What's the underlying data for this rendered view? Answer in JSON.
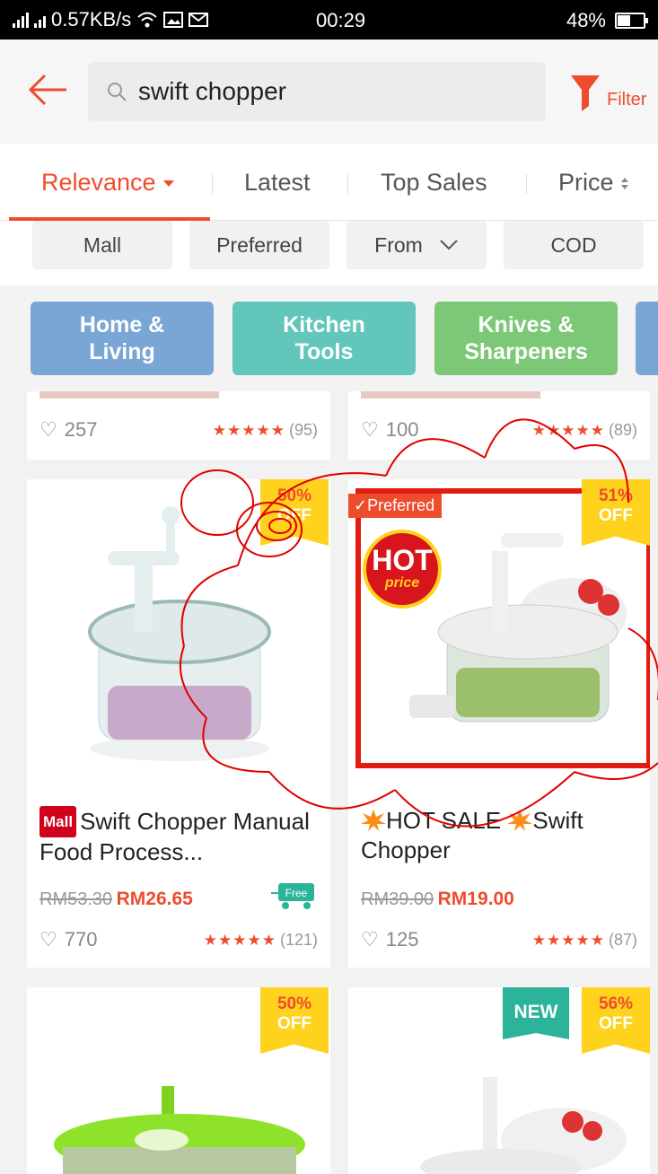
{
  "status_bar": {
    "network_speed": "0.57KB/s",
    "time": "00:29",
    "battery": "48%"
  },
  "header": {
    "search_query": "swift chopper",
    "filter_label": "Filter"
  },
  "sort_tabs": [
    {
      "label": "Relevance"
    },
    {
      "label": "Latest"
    },
    {
      "label": "Top Sales"
    },
    {
      "label": "Price"
    }
  ],
  "filter_chips": [
    {
      "label": "Mall"
    },
    {
      "label": "Preferred"
    },
    {
      "label": "From"
    },
    {
      "label": "COD"
    }
  ],
  "categories": [
    {
      "line1": "Home &",
      "line2": "Living",
      "color": "#7aa6d6"
    },
    {
      "line1": "Kitchen",
      "line2": "Tools",
      "color": "#62c6bb"
    },
    {
      "line1": "Knives &",
      "line2": "Sharpeners",
      "color": "#7cc877"
    }
  ],
  "top_row": [
    {
      "likes": "257",
      "stars": "★★★★★",
      "rating_count": "(95)"
    },
    {
      "likes": "100",
      "stars": "★★★★★",
      "rating_count": "(89)"
    }
  ],
  "products": [
    {
      "discount": "50%",
      "off": "OFF",
      "mall_tag": "Mall",
      "title": "Swift Chopper Manual Food Process...",
      "old_price": "RM53.30",
      "new_price": "RM26.65",
      "free_label": "Free",
      "likes": "770",
      "stars": "★★★★★",
      "rating_count": "(121)"
    },
    {
      "discount": "51%",
      "off": "OFF",
      "preferred_tag": "Preferred",
      "hot_text": "HOT",
      "hot_sub": "price",
      "title": "HOT SALE",
      "title_rest": "Swift Chopper",
      "old_price": "RM39.00",
      "new_price": "RM19.00",
      "likes": "125",
      "stars": "★★★★★",
      "rating_count": "(87)"
    },
    {
      "discount": "50%",
      "off": "OFF"
    },
    {
      "new_tag": "NEW",
      "discount": "56%",
      "off": "OFF"
    }
  ],
  "colors": {
    "accent": "#ee4d2d",
    "badge": "#ffd21e",
    "annotation": "#e00000"
  }
}
